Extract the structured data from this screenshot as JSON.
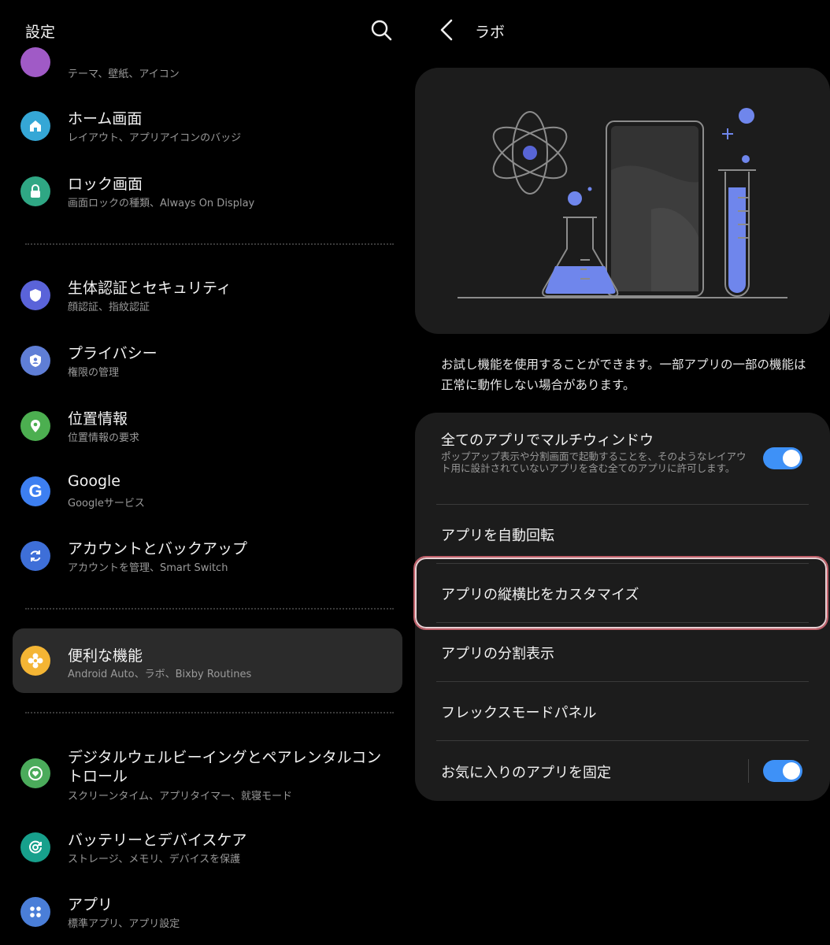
{
  "left": {
    "title": "設定",
    "partial_subtitle": "テーマ、壁紙、アイコン",
    "items": [
      {
        "title": "ホーム画面",
        "subtitle": "レイアウト、アプリアイコンのバッジ",
        "icon": "home-icon",
        "color": "#35a7d6"
      },
      {
        "title": "ロック画面",
        "subtitle": "画面ロックの種類、Always On Display",
        "icon": "lock-icon",
        "color": "#2fa784"
      },
      {
        "title": "生体認証とセキュリティ",
        "subtitle": "顔認証、指紋認証",
        "icon": "shield-icon",
        "color": "#5a63d9"
      },
      {
        "title": "プライバシー",
        "subtitle": "権限の管理",
        "icon": "privacy-icon",
        "color": "#5f7ed6"
      },
      {
        "title": "位置情報",
        "subtitle": "位置情報の要求",
        "icon": "location-icon",
        "color": "#4caf50"
      },
      {
        "title": "Google",
        "subtitle": "Googleサービス",
        "icon": "google-icon",
        "color": "#3d7ff1"
      },
      {
        "title": "アカウントとバックアップ",
        "subtitle": "アカウントを管理、Smart Switch",
        "icon": "sync-icon",
        "color": "#3e6fd8"
      },
      {
        "title": "便利な機能",
        "subtitle": "Android Auto、ラボ、Bixby Routines",
        "icon": "puzzle-icon",
        "color": "#f4b534"
      },
      {
        "title": "デジタルウェルビーイングとペアレンタルコントロール",
        "subtitle": "スクリーンタイム、アプリタイマー、就寝モード",
        "icon": "wellbeing-icon",
        "color": "#4bab5b"
      },
      {
        "title": "バッテリーとデバイスケア",
        "subtitle": "ストレージ、メモリ、デバイスを保護",
        "icon": "device-care-icon",
        "color": "#17a08c"
      },
      {
        "title": "アプリ",
        "subtitle": "標準アプリ、アプリ設定",
        "icon": "apps-icon",
        "color": "#4a7ed8"
      }
    ]
  },
  "right": {
    "title": "ラボ",
    "description": "お試し機能を使用することができます。一部アプリの一部の機能は正常に動作しない場合があります。",
    "rows": [
      {
        "label": "全てのアプリでマルチウィンドウ",
        "sub": "ポップアップ表示や分割画面で起動することを、そのようなレイアウト用に設計されていないアプリを含む全てのアプリに許可します。",
        "toggle": true
      },
      {
        "label": "アプリを自動回転"
      },
      {
        "label": "アプリの縦横比をカスタマイズ"
      },
      {
        "label": "アプリの分割表示"
      },
      {
        "label": "フレックスモードパネル"
      },
      {
        "label": "お気に入りのアプリを固定",
        "toggle": true
      }
    ]
  },
  "colors": {
    "accent": "#3e91f7",
    "highlight": "#c0606a"
  }
}
